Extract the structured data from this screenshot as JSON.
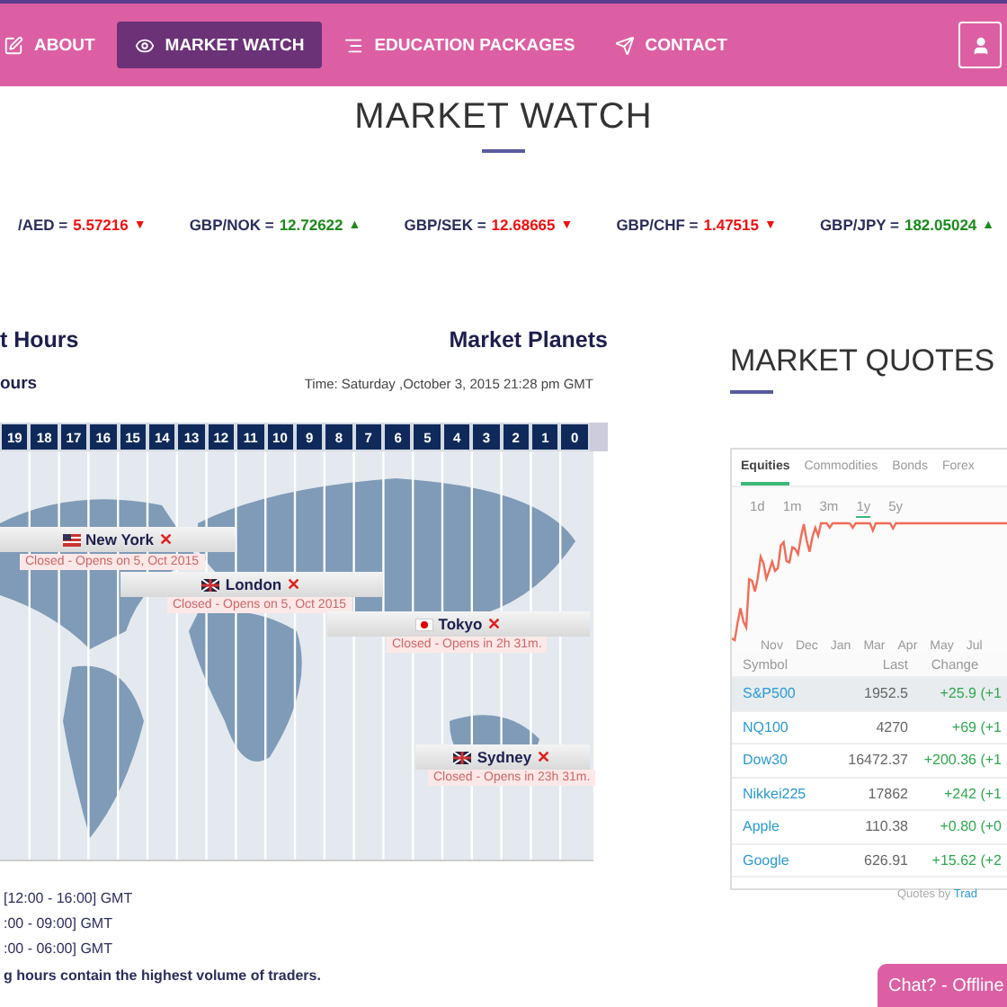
{
  "nav": {
    "items": [
      {
        "label": "ABOUT",
        "selected": false
      },
      {
        "label": "MARKET WATCH",
        "selected": true
      },
      {
        "label": "EDUCATION PACKAGES",
        "selected": false
      },
      {
        "label": "CONTACT",
        "selected": false
      }
    ]
  },
  "page_title": "MARKET WATCH",
  "ticker": [
    {
      "pair": "/AED =",
      "value": "5.57216",
      "up": false,
      "arrow": "▼"
    },
    {
      "pair": "GBP/NOK =",
      "value": "12.72622",
      "up": true,
      "arrow": "▲"
    },
    {
      "pair": "GBP/SEK =",
      "value": "12.68665",
      "up": false,
      "arrow": "▼"
    },
    {
      "pair": "GBP/CHF =",
      "value": "1.47515",
      "up": false,
      "arrow": "▼"
    },
    {
      "pair": "GBP/JPY =",
      "value": "182.05024",
      "up": true,
      "arrow": "▲"
    }
  ],
  "market_hours": {
    "title": "t Hours",
    "side_title": "Market Planets",
    "subtitle": "ours",
    "time": "Time: Saturday ,October 3, 2015 21:28 pm GMT",
    "hours": [
      "19",
      "18",
      "17",
      "16",
      "15",
      "14",
      "13",
      "12",
      "11",
      "10",
      "9",
      "8",
      "7",
      "6",
      "5",
      "4",
      "3",
      "2",
      "1",
      "0"
    ],
    "markets": [
      {
        "name": "New York",
        "open": false,
        "mark": "✕",
        "status": "Closed - Opens on 5, Oct 2015"
      },
      {
        "name": "London",
        "open": false,
        "mark": "✕",
        "status": "Closed - Opens on 5, Oct 2015"
      },
      {
        "name": "Tokyo",
        "open": false,
        "mark": "✕",
        "status": "Closed - Opens in 2h 31m."
      },
      {
        "name": "Sydney",
        "open": false,
        "mark": "✕",
        "status": "Closed - Opens in 23h 31m."
      }
    ],
    "sessions": [
      "[12:00 - 16:00] GMT",
      ":00 - 09:00] GMT",
      ":00 - 06:00] GMT"
    ],
    "note": "g hours contain the highest volume of traders."
  },
  "market_quotes": {
    "title": "MARKET QUOTES",
    "tabs": [
      {
        "label": "Equities",
        "selected": true
      },
      {
        "label": "Commodities",
        "selected": false
      },
      {
        "label": "Bonds",
        "selected": false
      },
      {
        "label": "Forex",
        "selected": false
      }
    ],
    "ranges": [
      {
        "label": "1d",
        "selected": false
      },
      {
        "label": "1m",
        "selected": false
      },
      {
        "label": "3m",
        "selected": false
      },
      {
        "label": "1y",
        "selected": true
      },
      {
        "label": "5y",
        "selected": false
      }
    ],
    "x_labels": [
      "Nov",
      "Dec",
      "Jan",
      "Mar",
      "Apr",
      "May",
      "Jul"
    ],
    "columns": [
      "Symbol",
      "Last",
      "Change"
    ],
    "rows": [
      {
        "symbol": "S&P500",
        "last": "1952.5",
        "change": "+25.9 (+1",
        "selected": true
      },
      {
        "symbol": "NQ100",
        "last": "4270",
        "change": "+69 (+1",
        "selected": false
      },
      {
        "symbol": "Dow30",
        "last": "16472.37",
        "change": "+200.36 (+1",
        "selected": false
      },
      {
        "symbol": "Nikkei225",
        "last": "17862",
        "change": "+242 (+1",
        "selected": false
      },
      {
        "symbol": "Apple",
        "last": "110.38",
        "change": "+0.80 (+0",
        "selected": false
      },
      {
        "symbol": "Google",
        "last": "626.91",
        "change": "+15.62 (+2",
        "selected": false
      }
    ],
    "footer": "Quotes by",
    "footer_link": "Trad"
  },
  "chat_button": "Chat? - Offline"
}
